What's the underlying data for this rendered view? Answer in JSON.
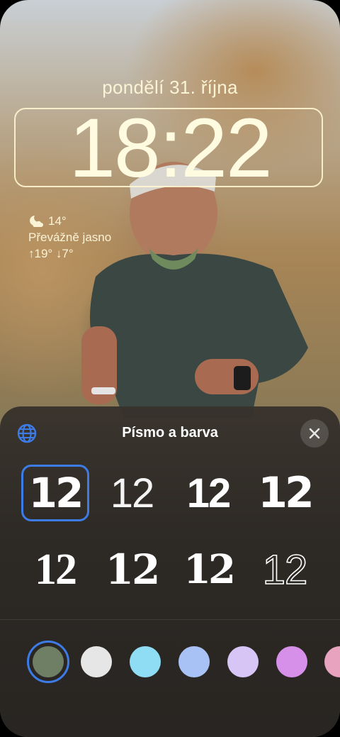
{
  "lockscreen": {
    "date": "pondělí 31. října",
    "time": "18:22",
    "weather": {
      "temp": "14°",
      "condition": "Převážně jasno",
      "range": "↑19° ↓7°",
      "icon": "moon-cloud-icon"
    }
  },
  "sheet": {
    "title": "Písmo a barva",
    "globe_icon": "globe-icon",
    "close_icon": "close-icon",
    "font_options": [
      {
        "label": "12",
        "style": "rounded-bold",
        "selected": true
      },
      {
        "label": "12",
        "style": "thin"
      },
      {
        "label": "12",
        "style": "bold"
      },
      {
        "label": "12",
        "style": "heavy"
      },
      {
        "label": "12",
        "style": "serif-light"
      },
      {
        "label": "12",
        "style": "serif-bold"
      },
      {
        "label": "12",
        "style": "slab"
      },
      {
        "label": "12",
        "style": "outline"
      }
    ],
    "colors": [
      {
        "hex": "#6f7f66",
        "selected": true
      },
      {
        "hex": "#e6e6e6"
      },
      {
        "hex": "#8fdcf5"
      },
      {
        "hex": "#a9c2f5"
      },
      {
        "hex": "#d6c5f5"
      },
      {
        "hex": "#d690ea"
      },
      {
        "hex": "#e8a3bf"
      }
    ]
  },
  "accent": "#3d7be6"
}
